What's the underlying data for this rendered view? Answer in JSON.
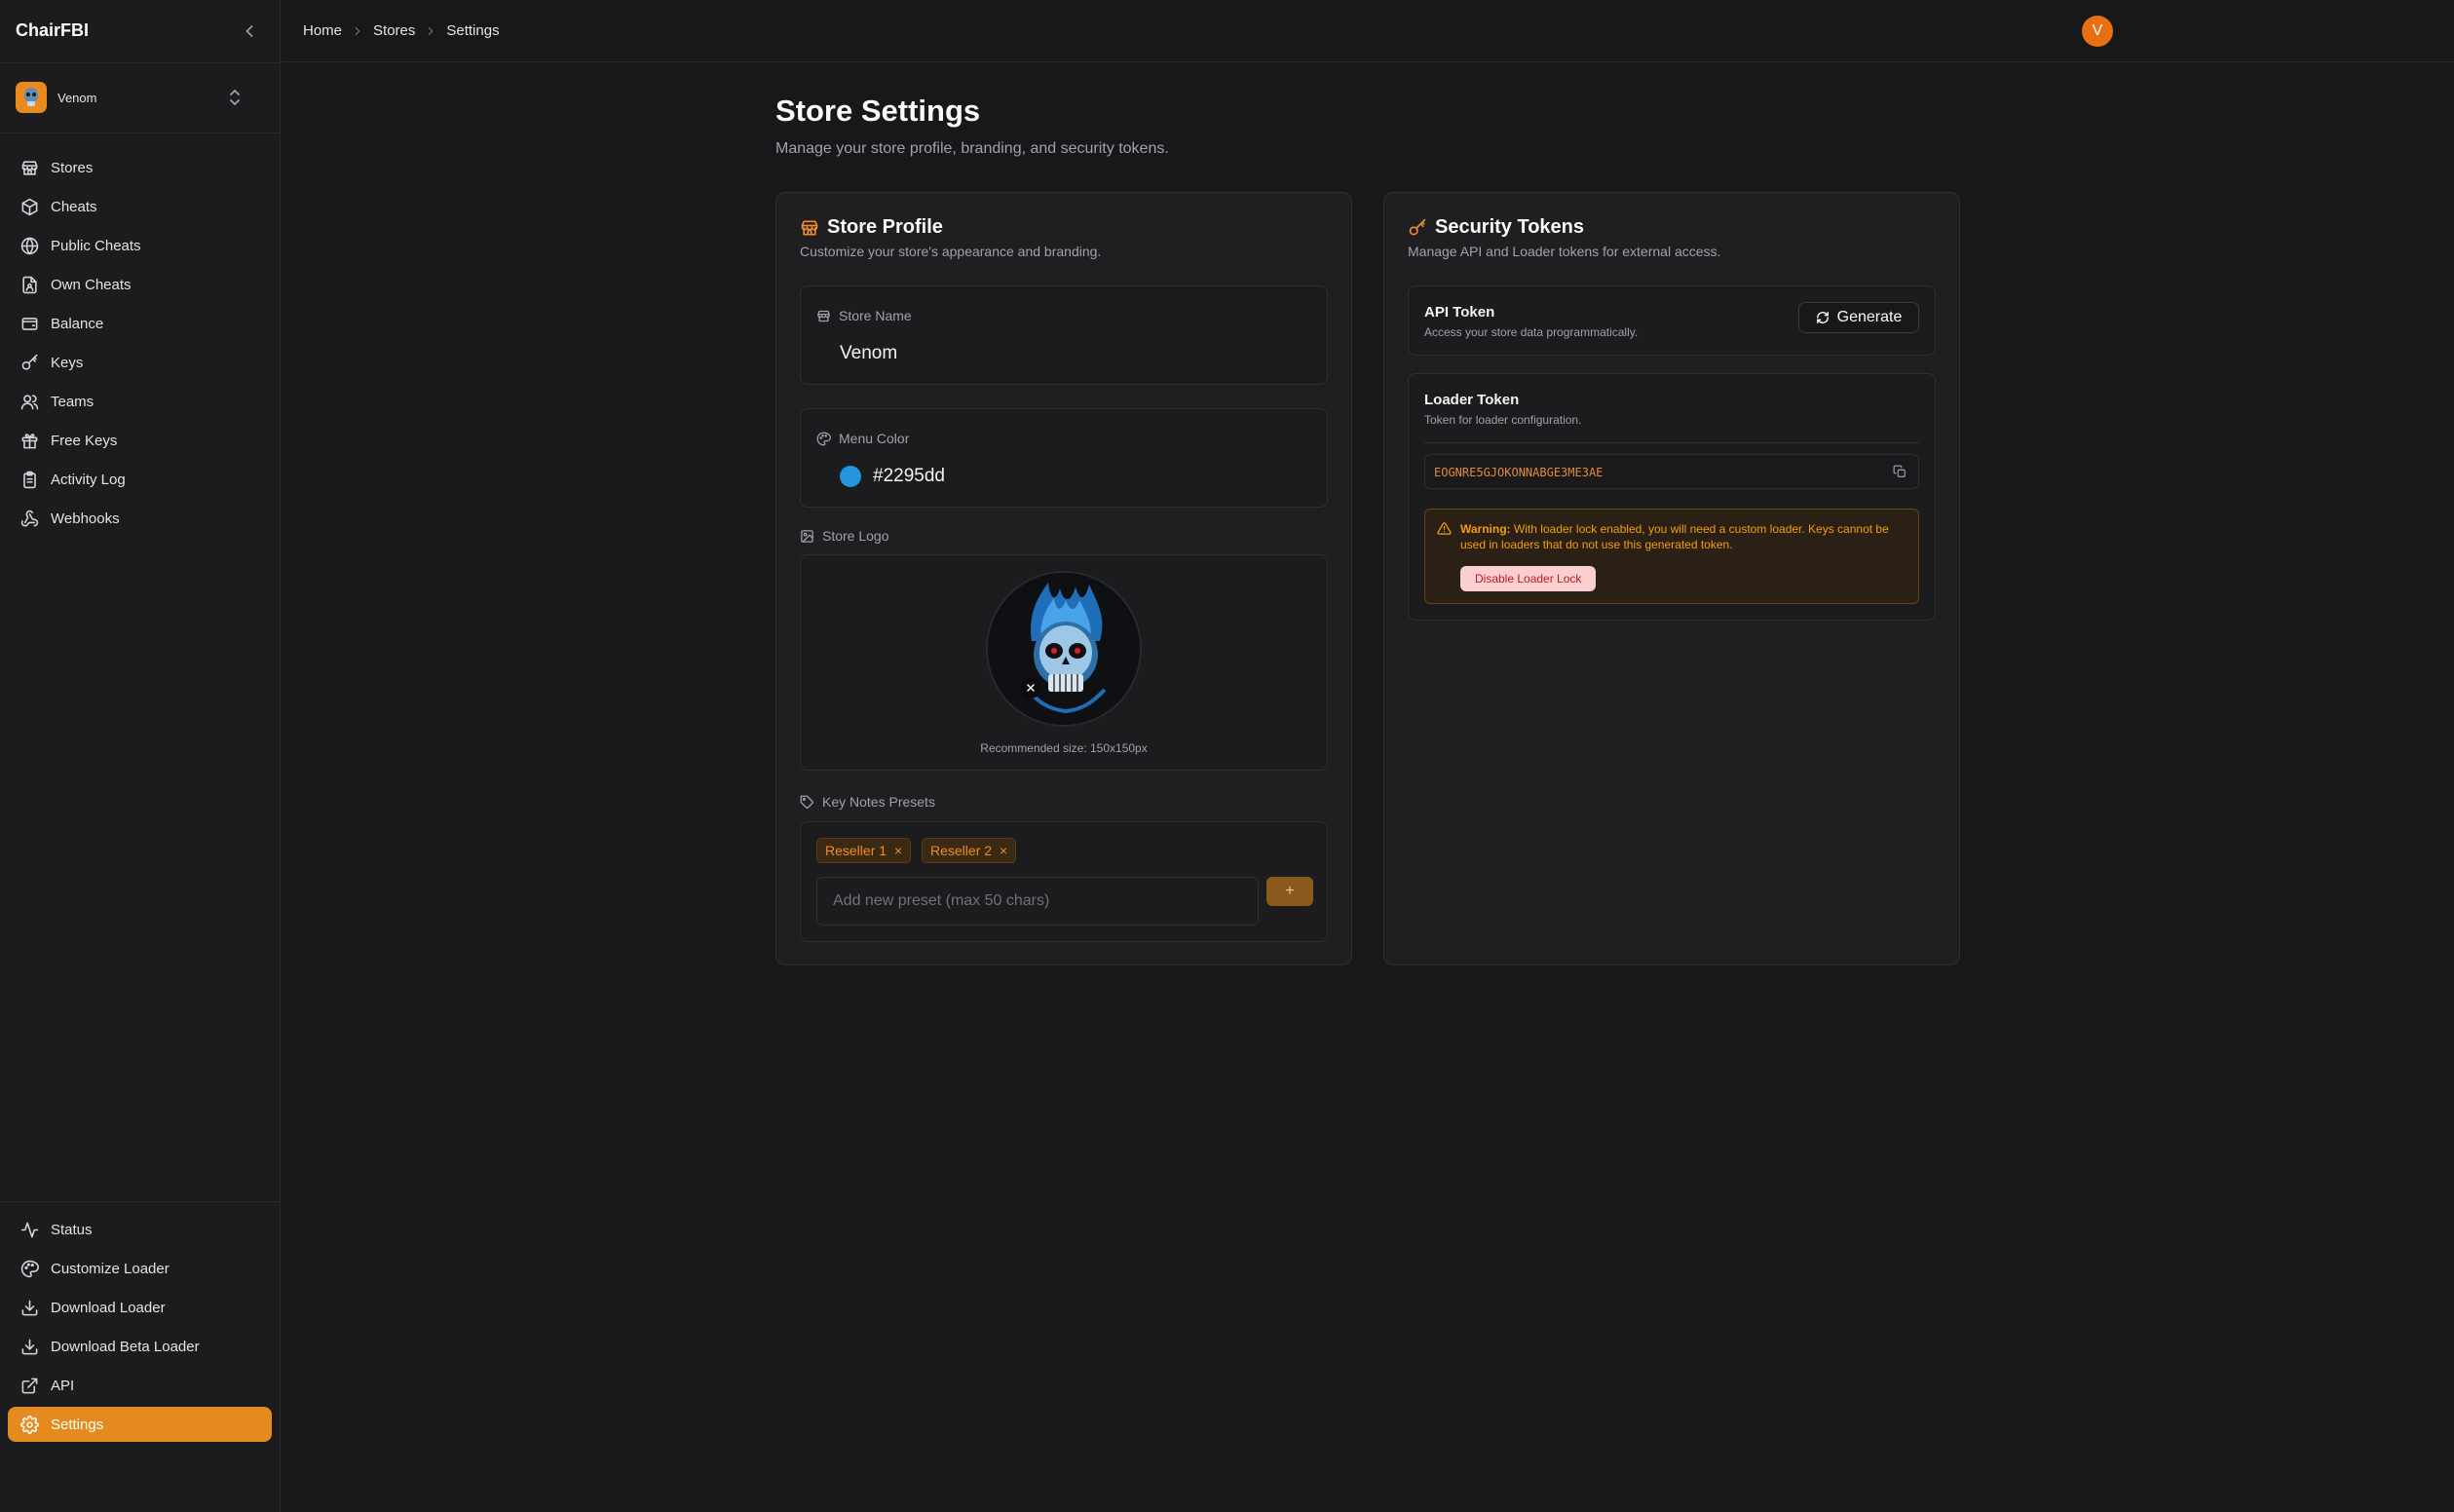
{
  "app": {
    "brand": "ChairFBI"
  },
  "store_switcher": {
    "name": "Venom"
  },
  "sidebar": {
    "main": [
      {
        "label": "Stores",
        "icon": "store-icon"
      },
      {
        "label": "Cheats",
        "icon": "package-icon"
      },
      {
        "label": "Public Cheats",
        "icon": "globe-icon"
      },
      {
        "label": "Own Cheats",
        "icon": "file-user-icon"
      },
      {
        "label": "Balance",
        "icon": "wallet-icon"
      },
      {
        "label": "Keys",
        "icon": "key-icon"
      },
      {
        "label": "Teams",
        "icon": "users-icon"
      },
      {
        "label": "Free Keys",
        "icon": "gift-icon"
      },
      {
        "label": "Activity Log",
        "icon": "clipboard-list-icon"
      },
      {
        "label": "Webhooks",
        "icon": "webhook-icon"
      }
    ],
    "bottom": [
      {
        "label": "Status",
        "icon": "activity-icon"
      },
      {
        "label": "Customize Loader",
        "icon": "palette-icon"
      },
      {
        "label": "Download Loader",
        "icon": "download-icon"
      },
      {
        "label": "Download Beta Loader",
        "icon": "download-beta-icon"
      },
      {
        "label": "API",
        "icon": "external-link-icon"
      },
      {
        "label": "Settings",
        "icon": "gear-icon",
        "active": true
      }
    ]
  },
  "header": {
    "breadcrumb": [
      "Home",
      "Stores",
      "Settings"
    ],
    "user_initial": "V"
  },
  "page": {
    "title": "Store Settings",
    "subtitle": "Manage your store profile, branding, and security tokens."
  },
  "profile": {
    "title": "Store Profile",
    "description": "Customize your store's appearance and branding.",
    "store_name_label": "Store Name",
    "store_name_value": "Venom",
    "menu_color_label": "Menu Color",
    "menu_color_value": "#2295dd",
    "logo_label": "Store Logo",
    "logo_hint": "Recommended size: 150x150px",
    "presets_label": "Key Notes Presets",
    "presets": [
      "Reseller 1",
      "Reseller 2"
    ],
    "preset_placeholder": "Add new preset (max 50 chars)",
    "add_label": "+"
  },
  "security": {
    "title": "Security Tokens",
    "description": "Manage API and Loader tokens for external access.",
    "api_title": "API Token",
    "api_desc": "Access your store data programmatically.",
    "generate_label": "Generate",
    "loader_title": "Loader Token",
    "loader_desc": "Token for loader configuration.",
    "loader_token": "EOGNRE5GJOKONNABGE3ME3AE",
    "warning_bold": "Warning:",
    "warning_text": " With loader lock enabled, you will need a custom loader. Keys cannot be used in loaders that do not use this generated token.",
    "disable_label": "Disable Loader Lock"
  },
  "colors": {
    "accent": "#e58a1f",
    "menu_color": "#2295dd",
    "warning": "#f59e0b"
  }
}
